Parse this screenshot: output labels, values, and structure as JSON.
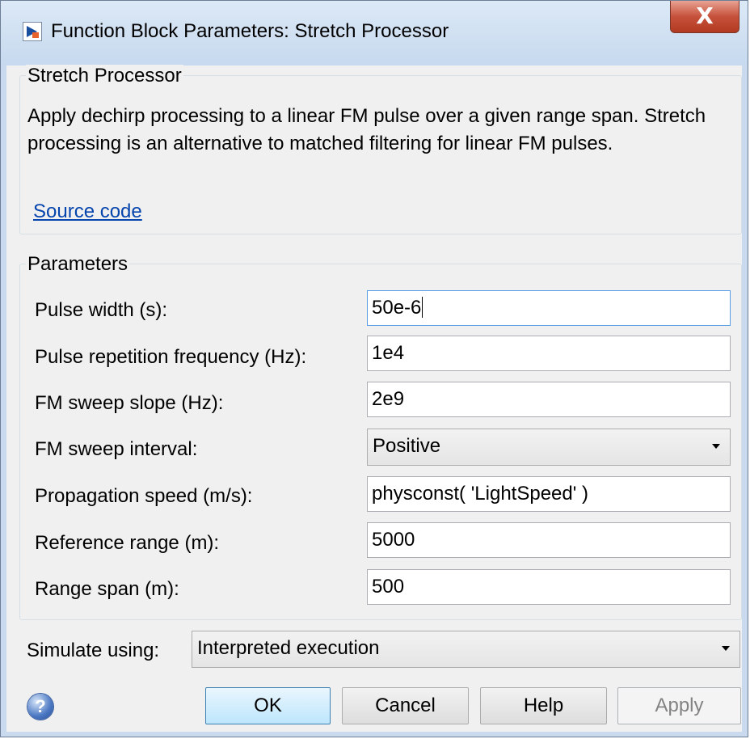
{
  "window": {
    "title": "Function Block Parameters: Stretch Processor",
    "close_glyph": "X"
  },
  "block": {
    "group_title": "Stretch Processor",
    "description": "Apply dechirp processing to a linear FM pulse over a given range span. Stretch processing is an alternative to matched filtering for linear FM pulses.",
    "source_link": "Source code"
  },
  "parameters": {
    "group_title": "Parameters",
    "rows": [
      {
        "label": "Pulse width (s):",
        "value": "50e-6"
      },
      {
        "label": "Pulse repetition frequency (Hz):",
        "value": "1e4"
      },
      {
        "label": "FM sweep slope (Hz):",
        "value": "2e9"
      },
      {
        "label": "FM sweep interval:",
        "value": "Positive"
      },
      {
        "label": "Propagation speed (m/s):",
        "value": "physconst( 'LightSpeed' )"
      },
      {
        "label": "Reference range (m):",
        "value": "5000"
      },
      {
        "label": "Range span (m):",
        "value": "500"
      }
    ]
  },
  "simulate": {
    "label": "Simulate using:",
    "value": "Interpreted execution"
  },
  "buttons": {
    "help_icon_glyph": "?",
    "ok": "OK",
    "cancel": "Cancel",
    "help": "Help",
    "apply": "Apply"
  },
  "colors": {
    "title_bar": "#c6d9ee",
    "close_button": "#c6513b",
    "link": "#0645ad",
    "focus_border": "#569de5"
  }
}
